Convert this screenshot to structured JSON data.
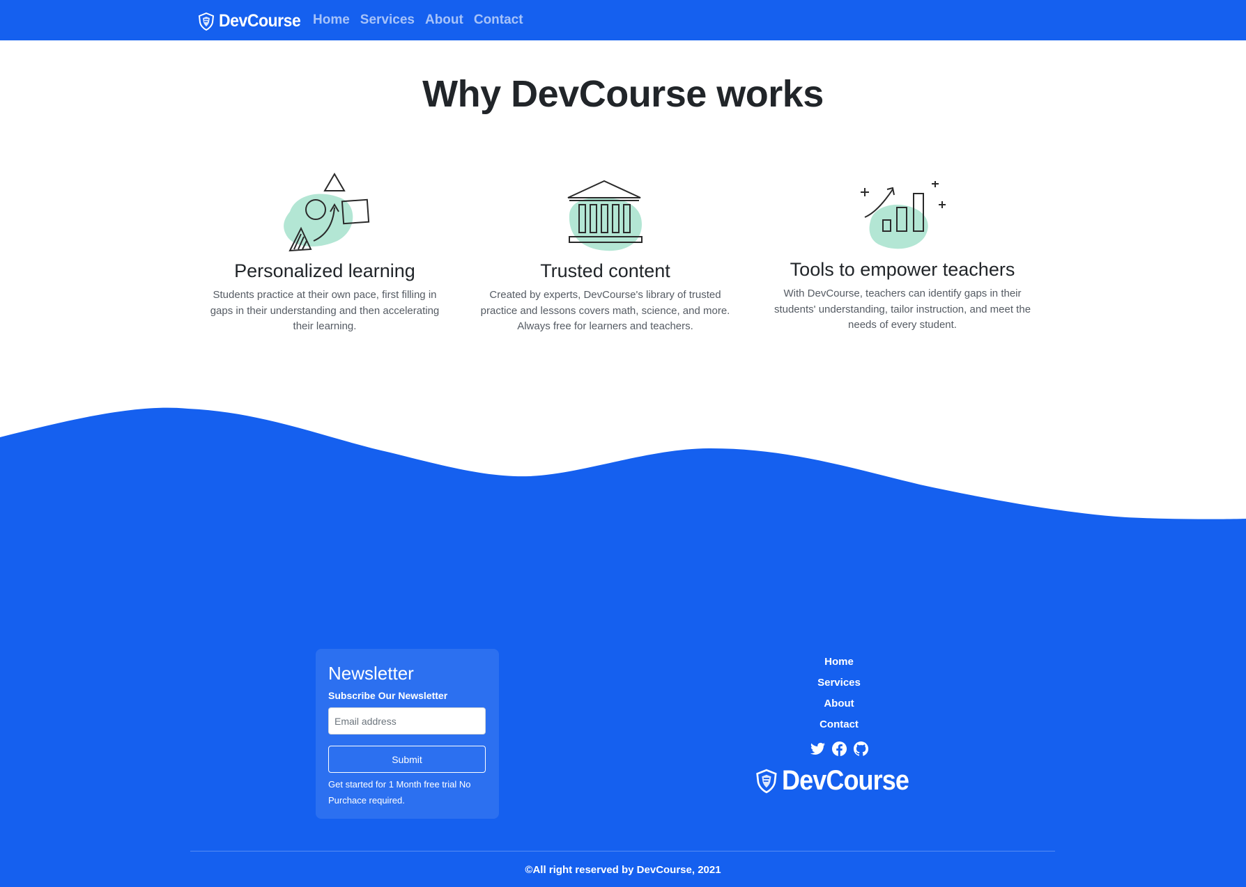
{
  "brand": {
    "name": "DevCourse",
    "logo_icon": "shield-logo-icon"
  },
  "nav": {
    "items": [
      {
        "label": "Home"
      },
      {
        "label": "Services"
      },
      {
        "label": "About"
      },
      {
        "label": "Contact"
      }
    ]
  },
  "main": {
    "title": "Why DevCourse works",
    "features": [
      {
        "icon": "shapes-arrow-illustration-icon",
        "title": "Personalized learning",
        "description": "Students practice at their own pace, first filling in gaps in their understanding and then accelerating their learning."
      },
      {
        "icon": "institution-building-illustration-icon",
        "title": "Trusted content",
        "description": "Created by experts, DevCourse's library of trusted practice and lessons covers math, science, and more. Always free for learners and teachers."
      },
      {
        "icon": "growth-bar-chart-illustration-icon",
        "title": "Tools to empower teachers",
        "description": "With DevCourse, teachers can identify gaps in their students' understanding, tailor instruction, and meet the needs of every student."
      }
    ]
  },
  "footer": {
    "newsletter": {
      "title": "Newsletter",
      "subtitle": "Subscribe Our Newsletter",
      "email_placeholder": "Email address",
      "email_value": "",
      "submit_label": "Submit",
      "note": "Get started for 1 Month free trial No Purchace required."
    },
    "links": [
      {
        "label": "Home"
      },
      {
        "label": "Services"
      },
      {
        "label": "About"
      },
      {
        "label": "Contact"
      }
    ],
    "socials": [
      "twitter-icon",
      "facebook-icon",
      "github-icon"
    ],
    "brand_name": "DevCourse",
    "copyright": "©All right reserved by DevCourse, 2021"
  },
  "colors": {
    "primary": "#1560ef",
    "illustration_accent": "#b3e6d4",
    "text_dark": "#212529",
    "text_muted": "#555b63"
  }
}
